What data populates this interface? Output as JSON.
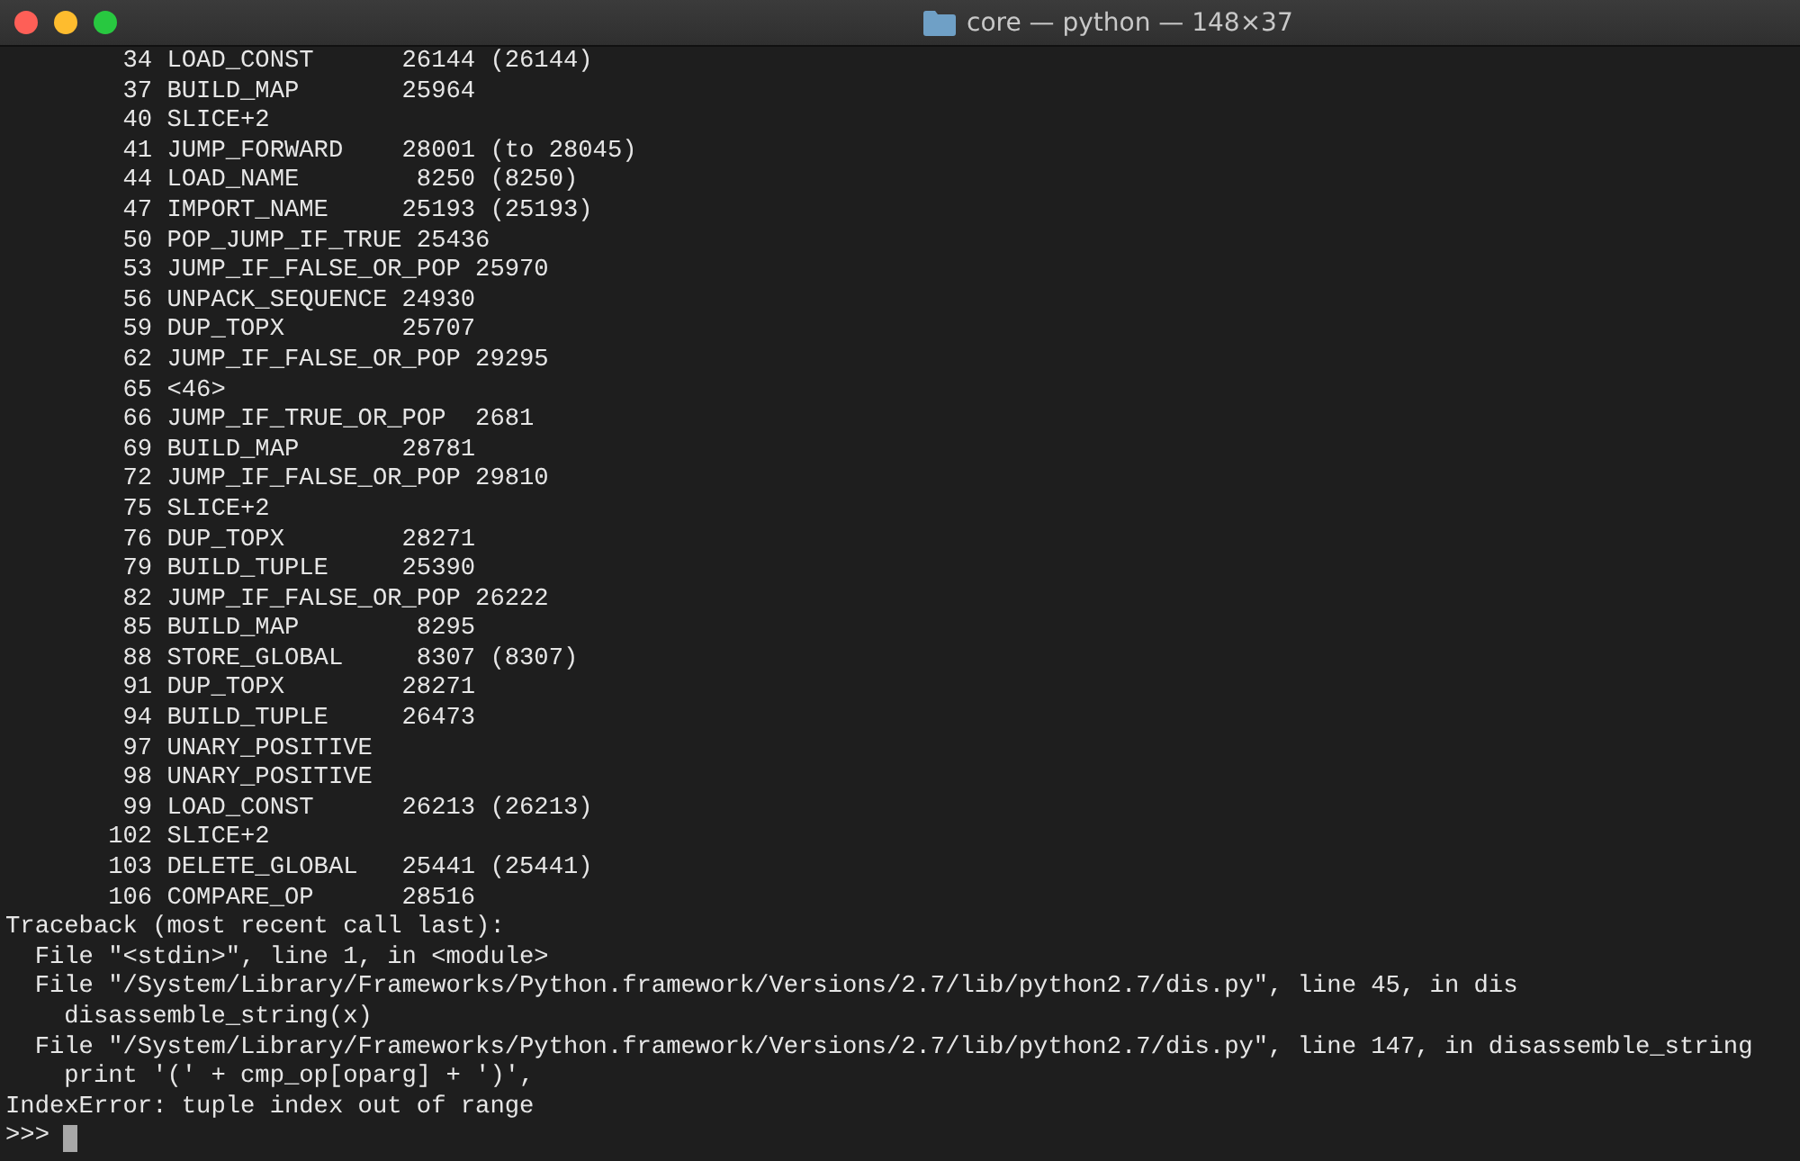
{
  "window": {
    "title": "core — python — 148×37"
  },
  "terminal": {
    "lines": [
      "        34 LOAD_CONST      26144 (26144)",
      "        37 BUILD_MAP       25964",
      "        40 SLICE+2",
      "        41 JUMP_FORWARD    28001 (to 28045)",
      "        44 LOAD_NAME        8250 (8250)",
      "        47 IMPORT_NAME     25193 (25193)",
      "        50 POP_JUMP_IF_TRUE 25436",
      "        53 JUMP_IF_FALSE_OR_POP 25970",
      "        56 UNPACK_SEQUENCE 24930",
      "        59 DUP_TOPX        25707",
      "        62 JUMP_IF_FALSE_OR_POP 29295",
      "        65 <46>",
      "        66 JUMP_IF_TRUE_OR_POP  2681",
      "        69 BUILD_MAP       28781",
      "        72 JUMP_IF_FALSE_OR_POP 29810",
      "        75 SLICE+2",
      "        76 DUP_TOPX        28271",
      "        79 BUILD_TUPLE     25390",
      "        82 JUMP_IF_FALSE_OR_POP 26222",
      "        85 BUILD_MAP        8295",
      "        88 STORE_GLOBAL     8307 (8307)",
      "        91 DUP_TOPX        28271",
      "        94 BUILD_TUPLE     26473",
      "        97 UNARY_POSITIVE",
      "        98 UNARY_POSITIVE",
      "        99 LOAD_CONST      26213 (26213)",
      "       102 SLICE+2",
      "       103 DELETE_GLOBAL   25441 (25441)",
      "       106 COMPARE_OP      28516",
      "Traceback (most recent call last):",
      "  File \"<stdin>\", line 1, in <module>",
      "  File \"/System/Library/Frameworks/Python.framework/Versions/2.7/lib/python2.7/dis.py\", line 45, in dis",
      "    disassemble_string(x)",
      "  File \"/System/Library/Frameworks/Python.framework/Versions/2.7/lib/python2.7/dis.py\", line 147, in disassemble_string",
      "    print '(' + cmp_op[oparg] + ')',",
      "IndexError: tuple index out of range"
    ],
    "prompt": ">>>"
  }
}
